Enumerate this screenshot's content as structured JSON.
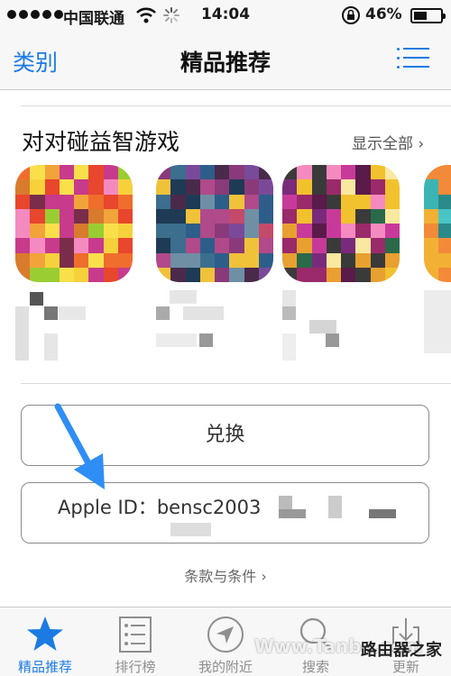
{
  "status_bar": {
    "carrier": "中国联通",
    "time": "14:04",
    "battery": "46%",
    "icons": [
      "signal-dots-icon",
      "wifi-icon",
      "loading-spinner-icon",
      "orientation-lock-icon",
      "battery-icon"
    ]
  },
  "nav": {
    "back_label": "类别",
    "title": "精品推荐",
    "menu_icon": "list-menu-icon",
    "accent_color": "#1c7be3"
  },
  "section": {
    "title": "对对碰益智游戏",
    "see_all": "显示全部 ›"
  },
  "buttons": {
    "redeem": "兑换",
    "apple_id": "Apple ID：bensc2003"
  },
  "terms": "条款与条件 ›",
  "tabs": [
    {
      "label": "精品推荐",
      "icon": "star-icon",
      "active": true
    },
    {
      "label": "排行榜",
      "icon": "ranking-list-icon",
      "active": false
    },
    {
      "label": "我的附近",
      "icon": "location-arrow-icon",
      "active": false
    },
    {
      "label": "搜索",
      "icon": "search-icon",
      "active": false
    },
    {
      "label": "更新",
      "icon": "update-download-icon",
      "active": false
    }
  ],
  "watermark": "Www.Tanbo.com",
  "watermark_site": "路由器之家"
}
